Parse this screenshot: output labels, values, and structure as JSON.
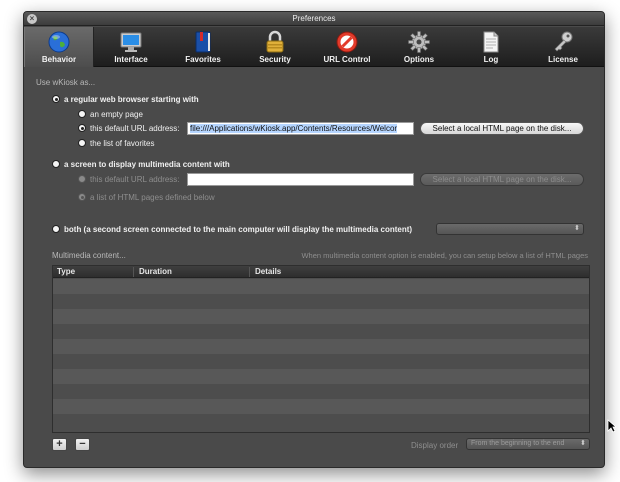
{
  "window": {
    "title": "Preferences"
  },
  "toolbar": {
    "tabs": [
      {
        "label": "Behavior",
        "icon": "globe-icon"
      },
      {
        "label": "Interface",
        "icon": "monitor-icon"
      },
      {
        "label": "Favorites",
        "icon": "book-icon"
      },
      {
        "label": "Security",
        "icon": "padlock-icon"
      },
      {
        "label": "URL Control",
        "icon": "no-entry-icon"
      },
      {
        "label": "Options",
        "icon": "gear-icon"
      },
      {
        "label": "Log",
        "icon": "document-icon"
      },
      {
        "label": "License",
        "icon": "key-icon"
      }
    ],
    "active": "Behavior"
  },
  "behavior": {
    "use_label": "Use wKiosk as...",
    "browser_option": "a regular web browser starting with",
    "empty_page": "an empty page",
    "default_url_label": "this default URL address:",
    "default_url_value": "file:///Applications/wKiosk.app/Contents/Resources/Welcor",
    "select_local_button": "Select a local HTML page on the disk...",
    "favorites_option": "the list of favorites",
    "screen_option": "a screen to display multimedia content with",
    "screen_default_url_label": "this default URL address:",
    "screen_default_url_value": "",
    "screen_select_local_button": "Select a local HTML page on the disk...",
    "html_list_option": "a list of HTML pages defined below",
    "both_option": "both (a second screen connected to the main computer will display the multimedia content)",
    "both_popup_value": ""
  },
  "multimedia": {
    "section_label": "Multimedia content...",
    "hint": "When multimedia content option is enabled, you can setup below a list of HTML pages",
    "columns": [
      "Type",
      "Duration",
      "Details"
    ],
    "rows": [],
    "add_label": "+",
    "remove_label": "−",
    "display_order_label": "Display order",
    "display_order_value": "From the beginning to the end"
  },
  "colors": {
    "window_bg": "#4a4a4a",
    "toolbar_bg": "#1e1e1e",
    "selection": "#b5d5ff"
  }
}
